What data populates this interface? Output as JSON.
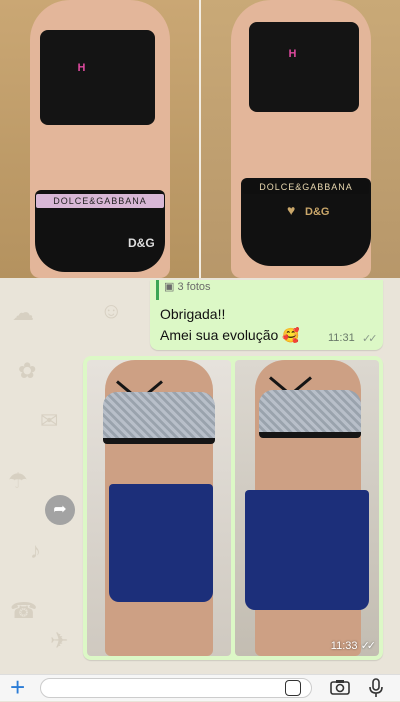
{
  "top_photo": {
    "left_band_text": "DOLCE&GABBANA",
    "left_brand_text": "D&G",
    "right_band_text": "DOLCE&GABBANA",
    "right_brand_text": "D&G"
  },
  "quoted": {
    "label": "3 fotos"
  },
  "text_message": {
    "line1": "Obrigada!!",
    "line2": "Amei sua evolução 🥰",
    "time": "11:31",
    "ticks": "✓✓"
  },
  "image_message": {
    "time": "11:33",
    "ticks": "✓✓"
  },
  "input": {
    "placeholder": ""
  },
  "colors": {
    "outgoing_bubble": "#dcf8c6",
    "chat_background": "#e9e4d9",
    "shorts": "#1c2f7a"
  }
}
